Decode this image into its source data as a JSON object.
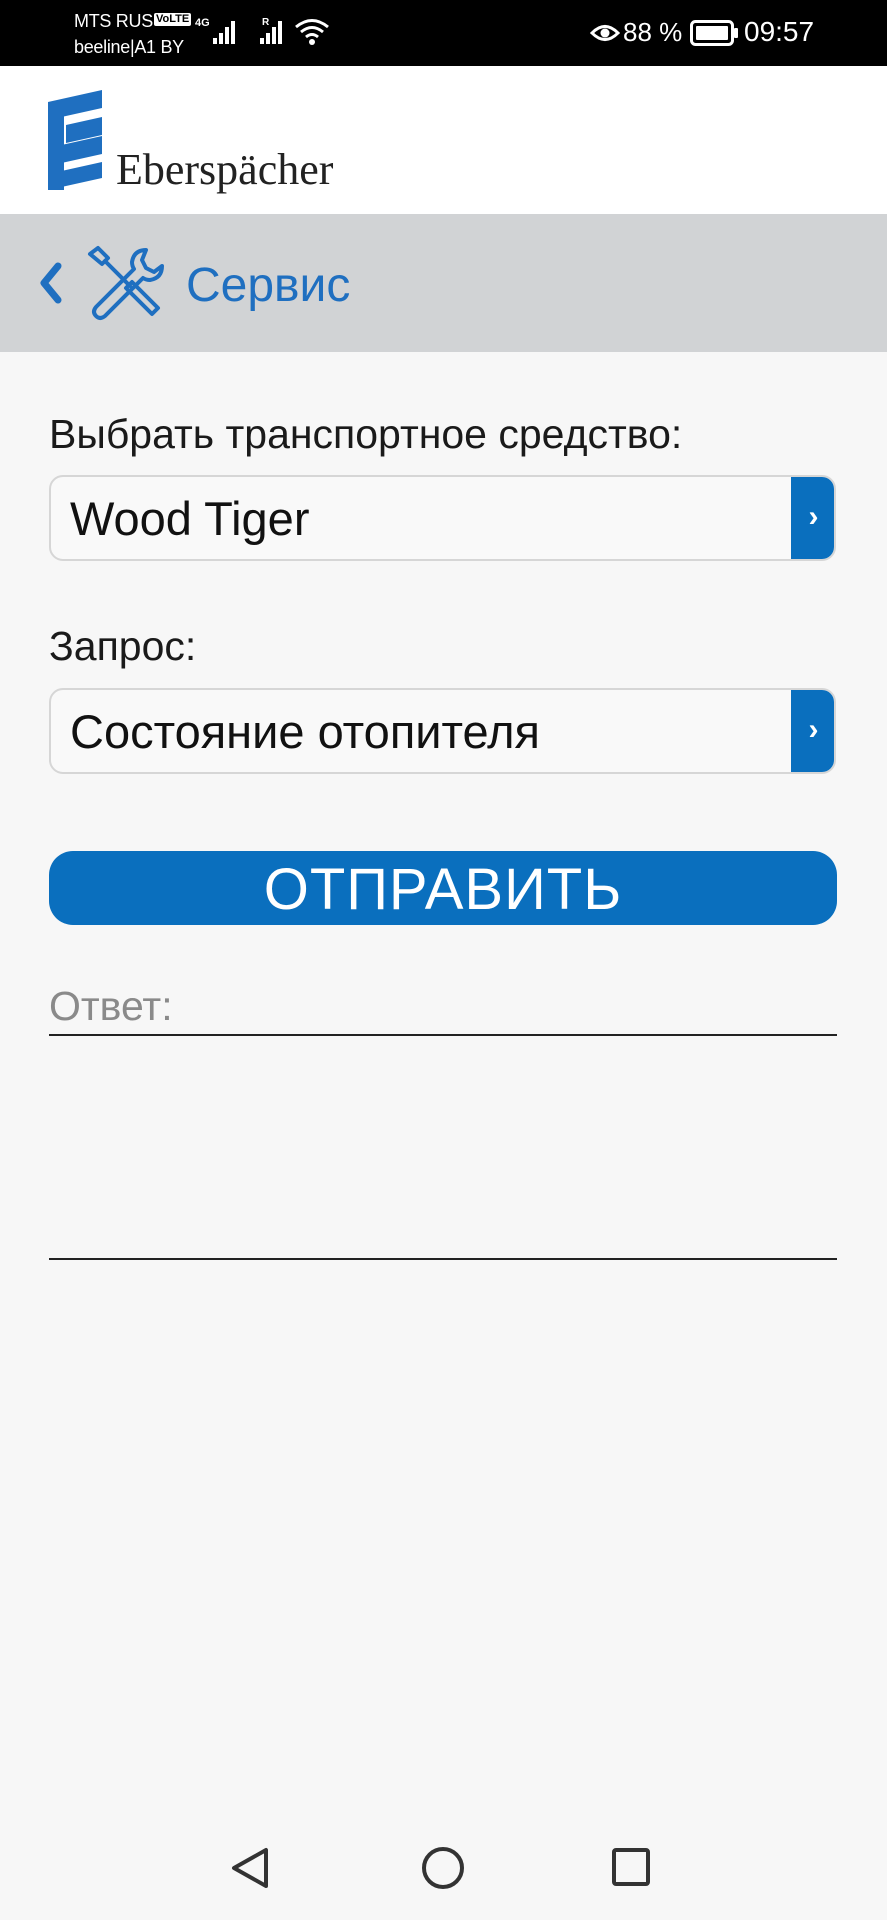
{
  "status_bar": {
    "carrier1": "MTS RUS",
    "volte": "VoLTE",
    "network_type": "4G",
    "roaming": "R",
    "carrier2": "beeline|A1 BY",
    "battery_percent": "88 %",
    "time": "09:57"
  },
  "brand": {
    "name": "Eberspächer",
    "color": "#1f6fc0"
  },
  "header": {
    "title": "Сервис",
    "back_icon": "chevron-left-icon",
    "section_icon": "tools-icon"
  },
  "form": {
    "vehicle_label": "Выбрать транспортное средство:",
    "vehicle_value": "Wood Tiger",
    "request_label": "Запрос:",
    "request_value": "Состояние отопителя",
    "select_arrow": "›",
    "send_label": "ОТПРАВИТЬ",
    "answer_label": "Ответ:"
  },
  "nav": {
    "back": "nav-back-icon",
    "home": "nav-home-icon",
    "recent": "nav-recent-icon"
  },
  "colors": {
    "accent": "#0a6fbe",
    "title_bar_bg": "#d1d3d5",
    "page_bg": "#f7f7f7"
  }
}
